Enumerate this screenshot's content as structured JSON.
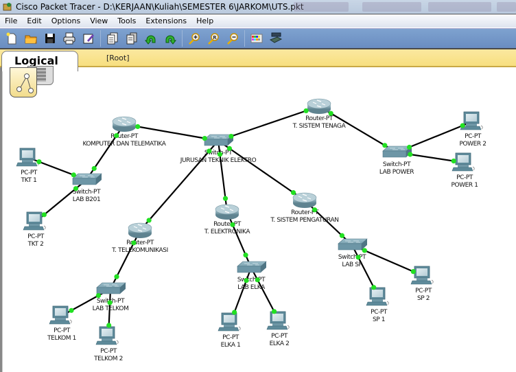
{
  "window": {
    "title": "Cisco Packet Tracer - D:\\KERJAAN\\Kuliah\\SEMESTER 6\\JARKOM\\UTS.pkt"
  },
  "menu": [
    "File",
    "Edit",
    "Options",
    "View",
    "Tools",
    "Extensions",
    "Help"
  ],
  "toolbar": {
    "buttons": [
      {
        "name": "new-icon"
      },
      {
        "name": "open-icon"
      },
      {
        "name": "save-icon"
      },
      {
        "name": "print-icon"
      },
      {
        "name": "activity-wizard-icon"
      },
      {
        "name": "copy-icon"
      },
      {
        "name": "paste-icon"
      },
      {
        "name": "undo-icon"
      },
      {
        "name": "redo-icon"
      },
      {
        "name": "zoom-in-icon"
      },
      {
        "name": "zoom-reset-icon"
      },
      {
        "name": "zoom-out-icon"
      },
      {
        "name": "palette-icon"
      },
      {
        "name": "custom-device-icon"
      }
    ]
  },
  "workspace": {
    "tab_label": "Logical",
    "path_label": "[Root]"
  },
  "colors": {
    "link": "#000000",
    "link_up": "#22e022",
    "toolbar": "#6f93c6",
    "workspace_bar": "#f9e288"
  },
  "topology": {
    "devices": [
      {
        "id": "r_ktm",
        "type": "router",
        "model": "Router-PT",
        "name": "KOMPUTER DAN TELEMATIKA"
      },
      {
        "id": "sw_core",
        "type": "switch",
        "model": "Switch-PT",
        "name": "JURUSAN TEKNIK ELEKTRO"
      },
      {
        "id": "r_tenaga",
        "type": "router",
        "model": "Router-PT",
        "name": "T. SISTEM TENAGA"
      },
      {
        "id": "sw_power",
        "type": "switch",
        "model": "Switch-PT",
        "name": "LAB POWER"
      },
      {
        "id": "pc_power2",
        "type": "pc",
        "model": "PC-PT",
        "name": "POWER 2"
      },
      {
        "id": "pc_power1",
        "type": "pc",
        "model": "PC-PT",
        "name": "POWER 1"
      },
      {
        "id": "pc_tkt1",
        "type": "pc",
        "model": "PC-PT",
        "name": "TKT 1"
      },
      {
        "id": "sw_b201",
        "type": "switch",
        "model": "Switch-PT",
        "name": "LAB B201"
      },
      {
        "id": "pc_tkt2",
        "type": "pc",
        "model": "PC-PT",
        "name": "TKT 2"
      },
      {
        "id": "r_telkom",
        "type": "router",
        "model": "Router-PT",
        "name": "T. TELEKOMUNIKASI"
      },
      {
        "id": "sw_telkom",
        "type": "switch",
        "model": "Switch-PT",
        "name": "LAB TELKOM"
      },
      {
        "id": "pc_telkom1",
        "type": "pc",
        "model": "PC-PT",
        "name": "TELKOM 1"
      },
      {
        "id": "pc_telkom2",
        "type": "pc",
        "model": "PC-PT",
        "name": "TELKOM 2"
      },
      {
        "id": "r_elka",
        "type": "router",
        "model": "Router-PT",
        "name": "T. ELEKTRONIKA"
      },
      {
        "id": "sw_elka",
        "type": "switch",
        "model": "Switch-PT",
        "name": "LAB ELKA"
      },
      {
        "id": "pc_elka1",
        "type": "pc",
        "model": "PC-PT",
        "name": "ELKA 1"
      },
      {
        "id": "pc_elka2",
        "type": "pc",
        "model": "PC-PT",
        "name": "ELKA 2"
      },
      {
        "id": "r_sp",
        "type": "router",
        "model": "Router-PT",
        "name": "T. SISTEM PENGATURAN"
      },
      {
        "id": "sw_sp",
        "type": "switch",
        "model": "Switch-PT",
        "name": "LAB SP"
      },
      {
        "id": "pc_sp1",
        "type": "pc",
        "model": "PC-PT",
        "name": "SP 1"
      },
      {
        "id": "pc_sp2",
        "type": "pc",
        "model": "PC-PT",
        "name": "SP 2"
      }
    ],
    "links": [
      [
        "r_ktm",
        "sw_core"
      ],
      [
        "sw_core",
        "r_tenaga"
      ],
      [
        "r_tenaga",
        "sw_power"
      ],
      [
        "sw_power",
        "pc_power2"
      ],
      [
        "sw_power",
        "pc_power1"
      ],
      [
        "r_ktm",
        "sw_b201"
      ],
      [
        "sw_b201",
        "pc_tkt1"
      ],
      [
        "sw_b201",
        "pc_tkt2"
      ],
      [
        "sw_core",
        "r_telkom"
      ],
      [
        "r_telkom",
        "sw_telkom"
      ],
      [
        "sw_telkom",
        "pc_telkom1"
      ],
      [
        "sw_telkom",
        "pc_telkom2"
      ],
      [
        "sw_core",
        "r_elka"
      ],
      [
        "r_elka",
        "sw_elka"
      ],
      [
        "sw_elka",
        "pc_elka1"
      ],
      [
        "sw_elka",
        "pc_elka2"
      ],
      [
        "sw_core",
        "r_sp"
      ],
      [
        "r_sp",
        "sw_sp"
      ],
      [
        "sw_sp",
        "pc_sp1"
      ],
      [
        "sw_sp",
        "pc_sp2"
      ]
    ]
  }
}
